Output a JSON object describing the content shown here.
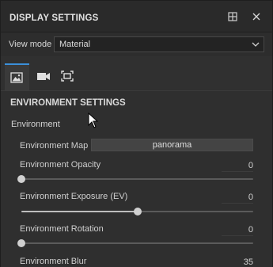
{
  "panel": {
    "title": "DISPLAY SETTINGS"
  },
  "view_mode": {
    "label": "View mode",
    "value": "Material"
  },
  "tabs": [
    {
      "name": "image-tab",
      "icon": "image-icon",
      "active": true
    },
    {
      "name": "camera-tab",
      "icon": "video-camera-icon",
      "active": false
    },
    {
      "name": "frame-tab",
      "icon": "frame-icon",
      "active": false
    }
  ],
  "environment_settings": {
    "title": "ENVIRONMENT SETTINGS",
    "group_label": "Environment",
    "map_label": "Environment Map",
    "map_value": "panorama",
    "rows": [
      {
        "label": "Environment Opacity",
        "value": "0",
        "level": 0
      },
      {
        "label": "Environment Exposure (EV)",
        "value": "0",
        "level": 0.5
      },
      {
        "label": "Environment Rotation",
        "value": "0",
        "level": 0
      },
      {
        "label": "Environment Blur",
        "value": "35"
      }
    ]
  },
  "colors": {
    "accent": "#3b8fd9",
    "panel_bg": "#303030"
  }
}
